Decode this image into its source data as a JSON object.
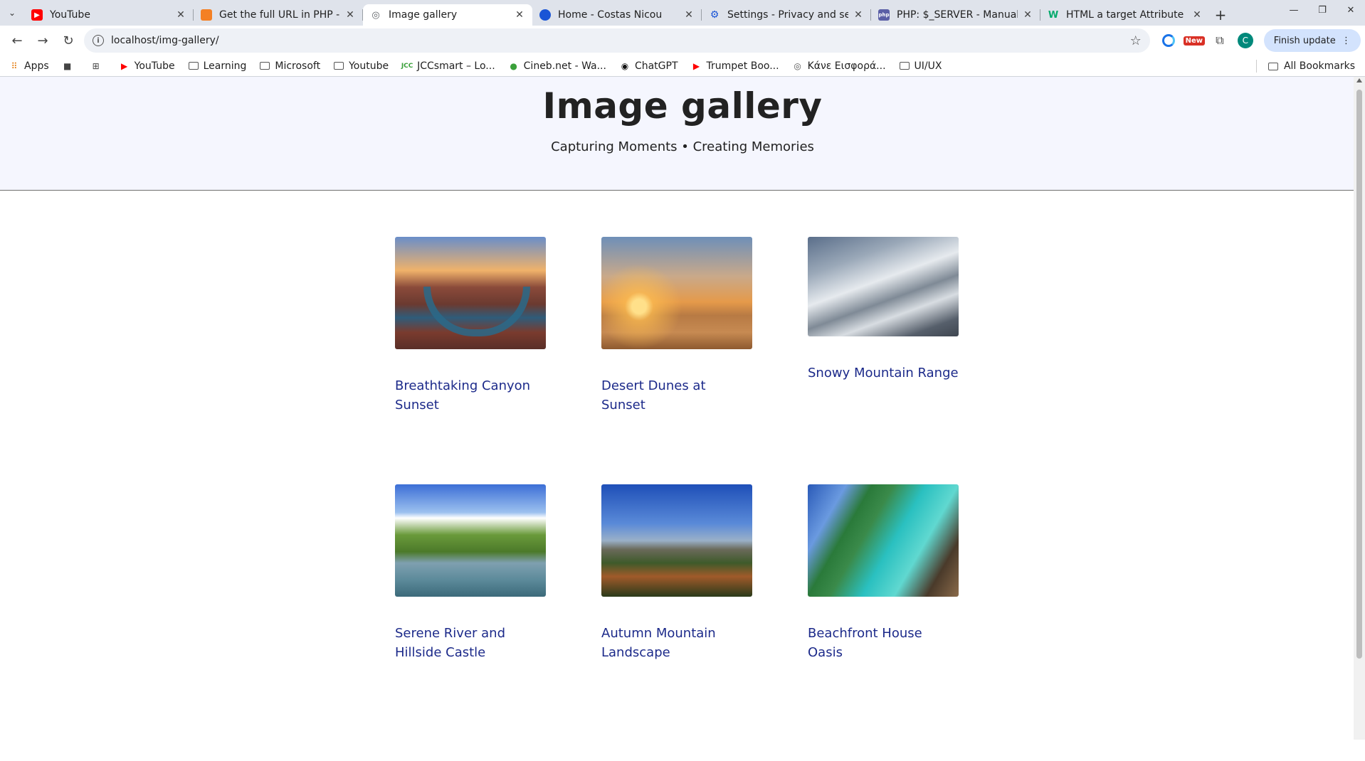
{
  "browser": {
    "tabs": [
      {
        "title": "YouTube",
        "icon": "youtube-icon",
        "color": "#ff0000",
        "active": false
      },
      {
        "title": "Get the full URL in PHP - ",
        "icon": "stackoverflow-icon",
        "color": "#f48024",
        "active": false
      },
      {
        "title": "Image gallery",
        "icon": "globe-icon",
        "color": "#5f6368",
        "active": true
      },
      {
        "title": "Home - Costas Nicou",
        "icon": "site-icon",
        "color": "#1a55d6",
        "active": false
      },
      {
        "title": "Settings - Privacy and sec",
        "icon": "gear-icon",
        "color": "#1a55d6",
        "active": false
      },
      {
        "title": "PHP: $_SERVER - Manual",
        "icon": "php-icon",
        "color": "#5b5fa6",
        "active": false
      },
      {
        "title": "HTML a target Attribute",
        "icon": "w3schools-icon",
        "color": "#04aa6d",
        "active": false
      }
    ],
    "url": "localhost/img-gallery/",
    "finish_update_label": "Finish update",
    "ext_new_label": "New",
    "avatar_letter": "C",
    "bookmarks": [
      {
        "label": "Apps",
        "icon": "apps-grid-icon"
      },
      {
        "label": "",
        "icon": "square-icon"
      },
      {
        "label": "",
        "icon": "grid-icon"
      },
      {
        "label": "YouTube",
        "icon": "youtube-icon"
      },
      {
        "label": "Learning",
        "icon": "folder-icon"
      },
      {
        "label": "Microsoft",
        "icon": "folder-icon"
      },
      {
        "label": "Youtube",
        "icon": "folder-icon"
      },
      {
        "label": "JCCsmart – Lo...",
        "icon": "jcc-icon"
      },
      {
        "label": "Cineb.net - Wa...",
        "icon": "cineb-icon"
      },
      {
        "label": "ChatGPT",
        "icon": "chatgpt-icon"
      },
      {
        "label": "Trumpet Boo...",
        "icon": "youtube-icon"
      },
      {
        "label": "Κάνε Εισφορά...",
        "icon": "globe-icon"
      },
      {
        "label": "UI/UX",
        "icon": "folder-icon"
      }
    ],
    "all_bookmarks_label": "All Bookmarks"
  },
  "page": {
    "title": "Image gallery",
    "subtitle": "Capturing Moments • Creating Memories",
    "gallery": [
      {
        "caption": "Breathtaking Canyon Sunset"
      },
      {
        "caption": "Desert Dunes at Sunset"
      },
      {
        "caption": "Snowy Mountain Range"
      },
      {
        "caption": "Serene River and Hillside Castle"
      },
      {
        "caption": "Autumn Mountain Landscape"
      },
      {
        "caption": "Beachfront House Oasis"
      }
    ]
  }
}
